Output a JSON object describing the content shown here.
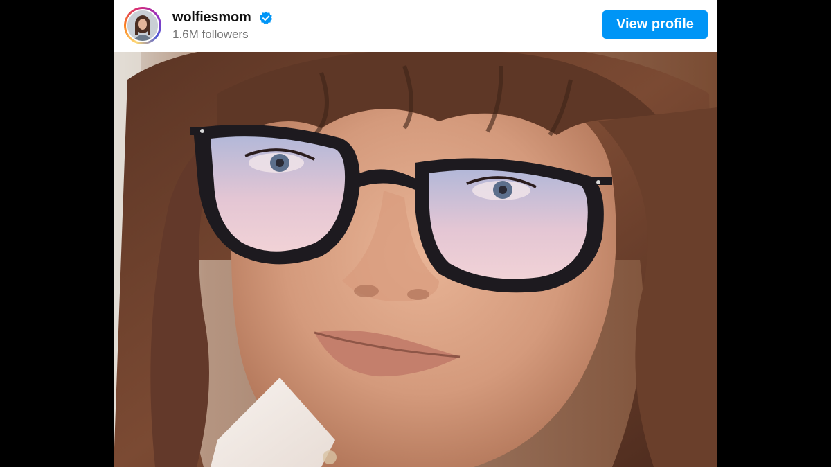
{
  "profile": {
    "username": "wolfiesmom",
    "verified": true,
    "followers": "1.6M followers",
    "view_profile_label": "View profile"
  },
  "icons": {
    "verified_badge": "verified-check-icon",
    "avatar": "profile-avatar"
  },
  "colors": {
    "accent": "#0095f6",
    "username": "#111111",
    "followers": "#737373",
    "background": "#000000"
  }
}
